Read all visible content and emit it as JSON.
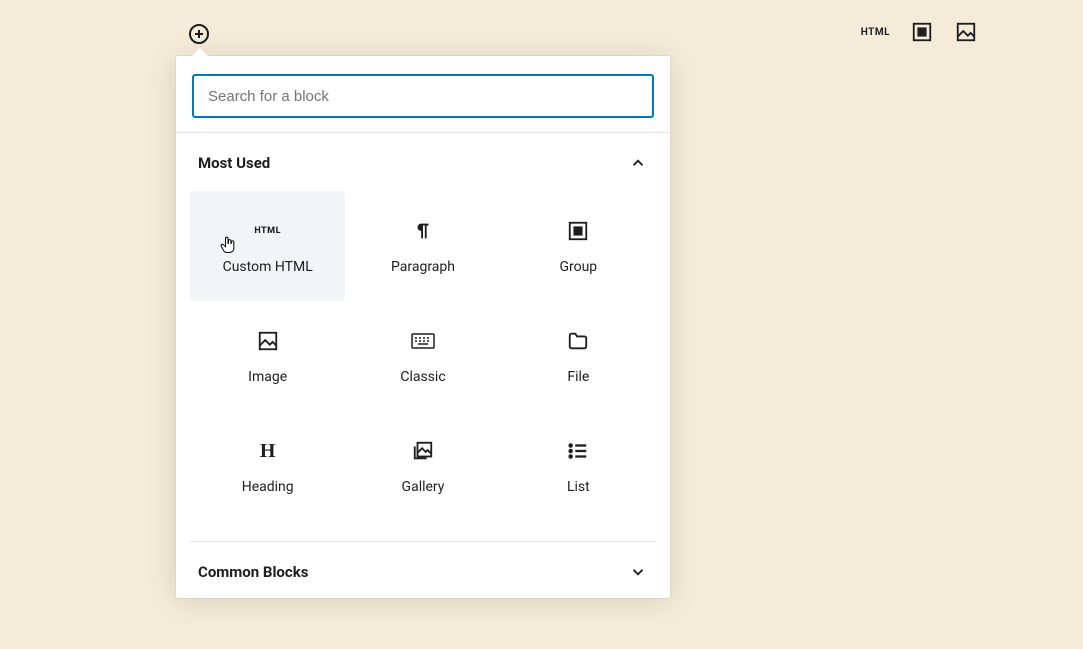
{
  "toolbar": {
    "right_html_label": "HTML"
  },
  "search": {
    "placeholder": "Search for a block",
    "value": ""
  },
  "sections": [
    {
      "title": "Most Used",
      "expanded": true,
      "blocks": [
        {
          "label": "Custom HTML",
          "icon": "html-icon",
          "hovered": true
        },
        {
          "label": "Paragraph",
          "icon": "paragraph-icon"
        },
        {
          "label": "Group",
          "icon": "group-icon"
        },
        {
          "label": "Image",
          "icon": "image-icon"
        },
        {
          "label": "Classic",
          "icon": "keyboard-icon"
        },
        {
          "label": "File",
          "icon": "folder-icon"
        },
        {
          "label": "Heading",
          "icon": "heading-icon"
        },
        {
          "label": "Gallery",
          "icon": "gallery-icon"
        },
        {
          "label": "List",
          "icon": "list-icon"
        }
      ]
    },
    {
      "title": "Common Blocks",
      "expanded": false
    }
  ]
}
